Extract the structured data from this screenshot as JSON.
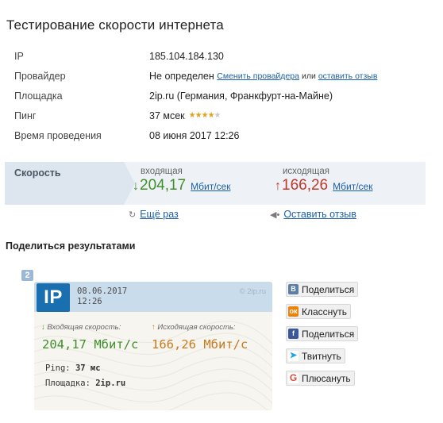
{
  "title": "Тестирование скорости интернета",
  "info": {
    "ip": {
      "label": "IP",
      "value": "185.104.184.130"
    },
    "provider": {
      "label": "Провайдер",
      "value": "Не определен",
      "change_link": "Сменить провайдера",
      "or": "или",
      "review_link": "оставить отзыв"
    },
    "place": {
      "label": "Площадка",
      "value": "2ip.ru (Германия, Франкфурт-на-Майне)"
    },
    "ping": {
      "label": "Пинг",
      "value": "37 мсек",
      "rating_filled": 4,
      "rating_max": 5
    },
    "time": {
      "label": "Время проведения",
      "value": "08 июня 2017 12:26"
    }
  },
  "speed": {
    "label": "Скорость",
    "incoming": {
      "caption": "входящая",
      "arrow": "↓",
      "value": "204,17",
      "unit": "Мбит/сек"
    },
    "outgoing": {
      "caption": "исходящая",
      "arrow": "↑",
      "value": "166,26",
      "unit": "Мбит/сек"
    }
  },
  "actions": {
    "again": "Ещё раз",
    "review": "Оставить отзыв"
  },
  "share": {
    "title": "Поделиться результатами",
    "badge": "2",
    "card": {
      "logo": "IP",
      "date": "08.06.2017",
      "time": "12:26",
      "brand": "© 2ip.ru",
      "in_caption": "Входящая скорость:",
      "out_caption": "Исходящая скорость:",
      "in_value": "204,17 Мбит/с",
      "out_value": "166,26 Мбит/с",
      "ping_label": "Ping:",
      "ping_value": "37 мс",
      "place_label": "Площадка:",
      "place_value": "2ip.ru"
    },
    "buttons": [
      {
        "icon": "vk-icon",
        "glyph": "В",
        "label": "Поделиться"
      },
      {
        "icon": "odnoklassniki-icon",
        "glyph": "ок",
        "label": "Класснуть"
      },
      {
        "icon": "facebook-icon",
        "glyph": "f",
        "label": "Поделиться"
      },
      {
        "icon": "twitter-icon",
        "glyph": "🐦",
        "label": "Твитнуть"
      },
      {
        "icon": "google-plus-icon",
        "glyph": "G",
        "label": "Плюсануть"
      }
    ]
  },
  "colors": {
    "incoming": "#3f8f2a",
    "outgoing": "#c0392b",
    "link": "#1a5fa8",
    "logo": "#1a6fb0"
  }
}
